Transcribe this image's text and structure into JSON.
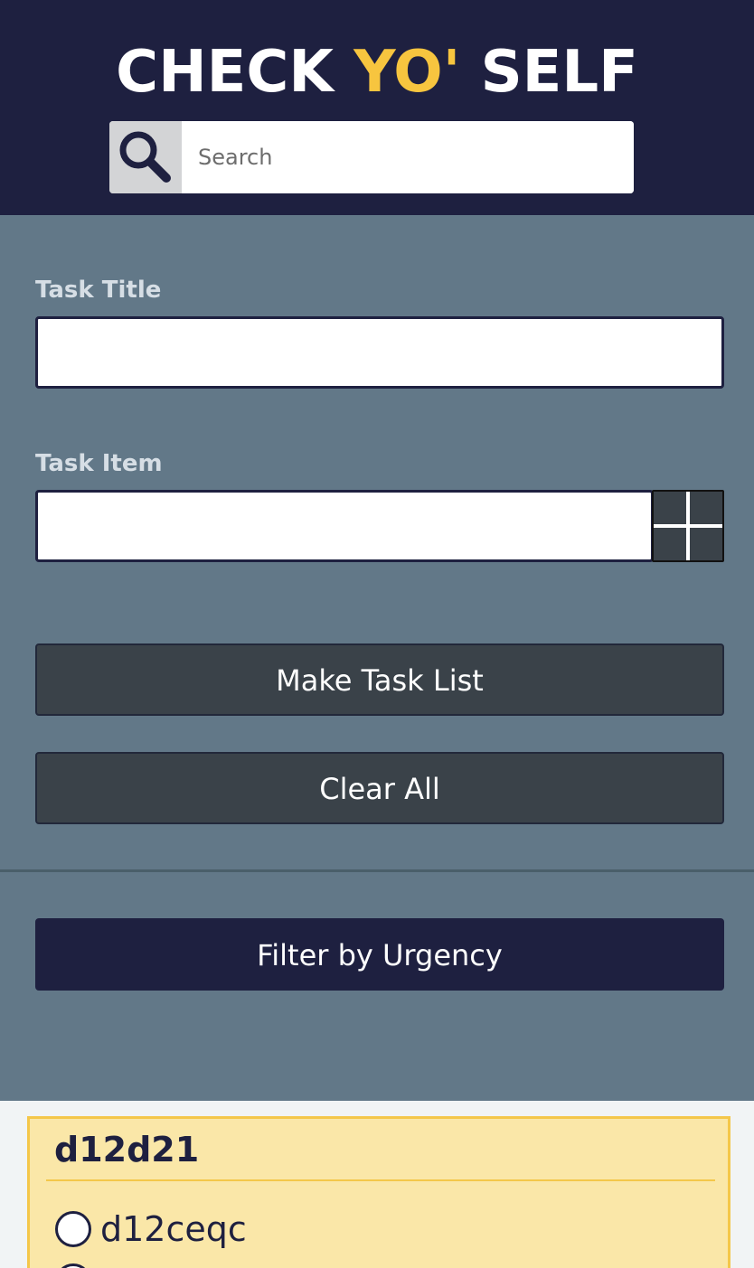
{
  "header": {
    "logo": {
      "part1": "CHECK ",
      "accent": "YO'",
      "part2": " SELF"
    },
    "search": {
      "placeholder": "Search",
      "icon": "search-icon"
    }
  },
  "form": {
    "task_title_label": "Task Title",
    "task_title_value": "",
    "task_item_label": "Task Item",
    "task_item_value": "",
    "add_item_icon": "plus-icon",
    "make_task_list_label": "Make Task List",
    "clear_all_label": "Clear All",
    "filter_label": "Filter by Urgency"
  },
  "cards": [
    {
      "title": "d12d21",
      "tasks": [
        {
          "text": "d12ceqc",
          "checked": false
        }
      ]
    }
  ],
  "colors": {
    "header_bg": "#1e2040",
    "accent": "#f7c53f",
    "form_bg": "#627888",
    "button_dark": "#3a4249",
    "card_bg": "#fae7a8",
    "card_border": "#f4c74a"
  }
}
